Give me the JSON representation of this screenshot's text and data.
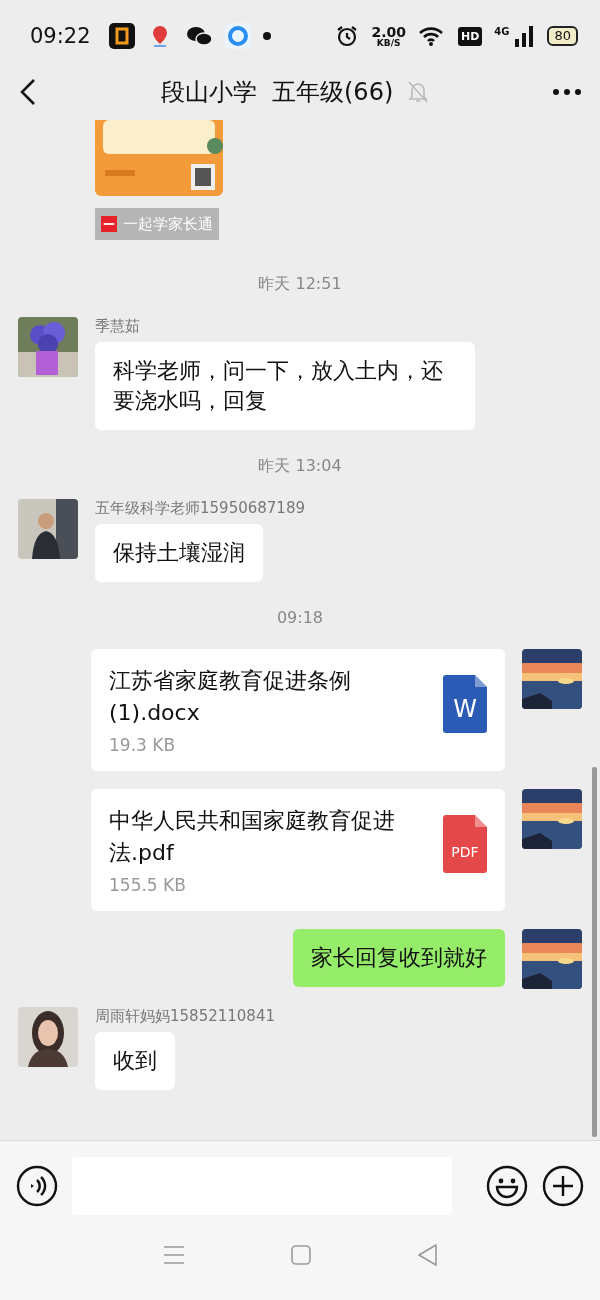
{
  "status_bar": {
    "time": "09:22",
    "speed": "2.00",
    "speed_unit": "KB/S",
    "hd": "HD",
    "network": "4G",
    "battery": "80"
  },
  "header": {
    "title": "段山小学  五年级(66)",
    "muted": true
  },
  "messages": [
    {
      "kind": "card",
      "source": "一起学家长通"
    },
    {
      "kind": "timestamp",
      "text": "昨天 12:51"
    },
    {
      "kind": "text",
      "outgoing": false,
      "sender": "季慧茹",
      "text": "科学老师，问一下，放入土内，还要浇水吗，回复"
    },
    {
      "kind": "timestamp",
      "text": "昨天 13:04"
    },
    {
      "kind": "text",
      "outgoing": false,
      "sender": "五年级科学老师15950687189",
      "text": "保持土壤湿润"
    },
    {
      "kind": "timestamp",
      "text": "09:18"
    },
    {
      "kind": "file",
      "outgoing": true,
      "name": "江苏省家庭教育促进条例(1).docx",
      "size": "19.3 KB",
      "icon": {
        "kind": "word",
        "label": "W"
      }
    },
    {
      "kind": "file",
      "outgoing": true,
      "name": "中华人民共和国家庭教育促进法.pdf",
      "size": "155.5 KB",
      "icon": {
        "kind": "pdf",
        "label": "PDF"
      }
    },
    {
      "kind": "text",
      "outgoing": true,
      "text": "家长回复收到就好"
    },
    {
      "kind": "text",
      "outgoing": false,
      "sender": "周雨轩妈妈15852110841",
      "text": "收到"
    }
  ]
}
